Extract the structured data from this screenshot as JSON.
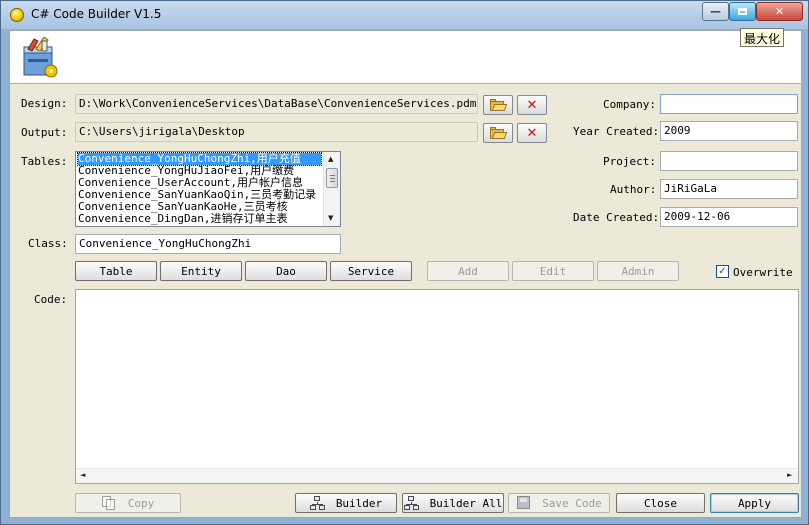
{
  "window": {
    "title": "C# Code Builder V1.5",
    "minimize_glyph": "—",
    "close_glyph": "✕",
    "maximize_tooltip": "最大化"
  },
  "form": {
    "design_label": "Design:",
    "design_value": "D:\\Work\\ConvenienceServices\\DataBase\\ConvenienceServices.pdm",
    "output_label": "Output:",
    "output_value": "C:\\Users\\jirigala\\Desktop",
    "tables_label": "Tables:",
    "class_label": "Class:",
    "class_value": "Convenience_YongHuChongZhi",
    "code_label": "Code:",
    "company_label": "Company:",
    "company_value": "",
    "year_created_label": "Year Created:",
    "year_created_value": "2009",
    "project_label": "Project:",
    "project_value": "",
    "author_label": "Author:",
    "author_value": "JiRiGaLa",
    "date_created_label": "Date Created:",
    "date_created_value": "2009-12-06"
  },
  "tables_list": {
    "items": [
      "Convenience_YongHuChongZhi,用户充值",
      "Convenience_YongHuJiaoFei,用户缴费",
      "Convenience_UserAccount,用户帐户信息",
      "Convenience_SanYuanKaoQin,三员考勤记录",
      "Convenience_SanYuanKaoHe,三员考核",
      "Convenience_DingDan,进销存订单主表"
    ],
    "selected_index": 0
  },
  "generate_buttons": {
    "table": "Table",
    "entity": "Entity",
    "dao": "Dao",
    "service": "Service"
  },
  "edit_buttons": {
    "add": "Add",
    "edit": "Edit",
    "admin": "Admin"
  },
  "overwrite": {
    "label": "Overwrite",
    "checked": true,
    "check_glyph": "✓"
  },
  "scroll_glyphs": {
    "up": "▲",
    "down": "▼",
    "left": "◄",
    "right": "►"
  },
  "bottom_buttons": {
    "copy": "Copy",
    "builder": "Builder",
    "builder_all": "Builder All",
    "save_code": "Save Code",
    "close": "Close",
    "apply": "Apply"
  },
  "icons": {
    "browse": "folder-open-icon",
    "clear": "red-x-icon",
    "copy": "copy-icon",
    "builder": "tree-icon",
    "save": "floppy-disk-icon"
  },
  "colors": {
    "title_bar": "#a9c3e2",
    "form_bg": "#ece9d8",
    "selection": "#3399ff",
    "close_btn": "#c9463a"
  }
}
